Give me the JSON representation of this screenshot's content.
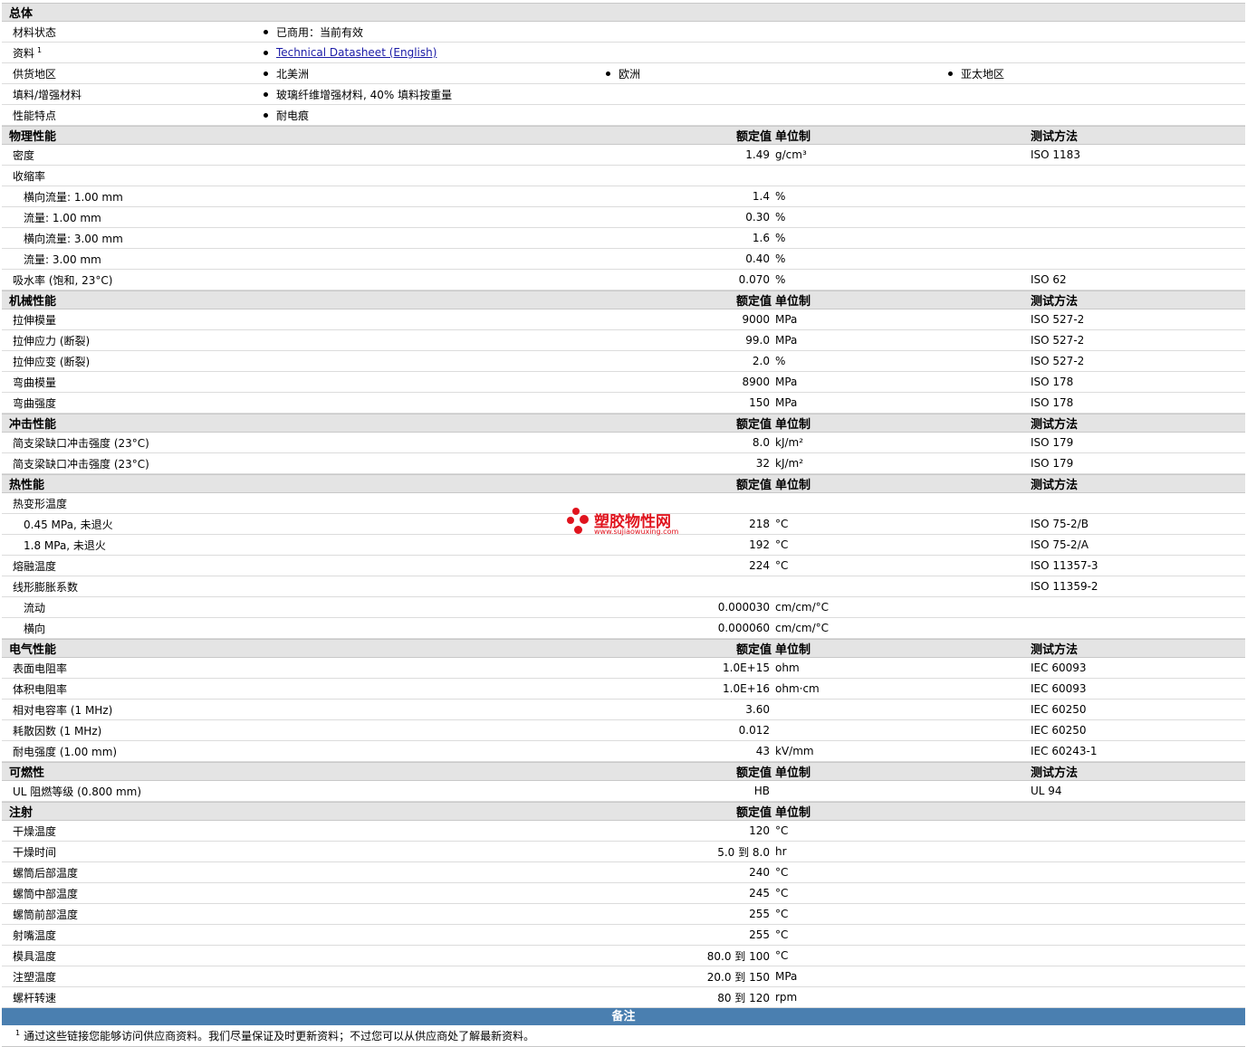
{
  "sections": [
    {
      "title": "总体",
      "headers": null,
      "rows": [
        {
          "type": "bullets",
          "label": "材料状态",
          "items": [
            "已商用：当前有效"
          ]
        },
        {
          "type": "bullets",
          "label": "资料",
          "sup": "1",
          "items": [
            "Technical Datasheet (English)"
          ],
          "link": true
        },
        {
          "type": "bullets",
          "label": "供货地区",
          "items": [
            "北美洲",
            "欧洲",
            "亚太地区"
          ]
        },
        {
          "type": "bullets",
          "label": "填料/增强材料",
          "items": [
            "玻璃纤维增强材料, 40% 填料按重量"
          ]
        },
        {
          "type": "bullets",
          "label": "性能特点",
          "items": [
            "耐电痕"
          ]
        }
      ]
    },
    {
      "title": "物理性能",
      "headers": {
        "value": "额定值",
        "unit": "单位制",
        "test": "测试方法"
      },
      "rows": [
        {
          "label": "密度",
          "value": "1.49",
          "unit": "g/cm³",
          "test": "ISO 1183"
        },
        {
          "label": "收缩率",
          "value": "",
          "unit": "",
          "test": ""
        },
        {
          "label": "横向流量: 1.00 mm",
          "sub": true,
          "value": "1.4",
          "unit": "%",
          "test": ""
        },
        {
          "label": "流量: 1.00 mm",
          "sub": true,
          "value": "0.30",
          "unit": "%",
          "test": ""
        },
        {
          "label": "横向流量: 3.00 mm",
          "sub": true,
          "value": "1.6",
          "unit": "%",
          "test": ""
        },
        {
          "label": "流量: 3.00 mm",
          "sub": true,
          "value": "0.40",
          "unit": "%",
          "test": ""
        },
        {
          "label": "吸水率 (饱和, 23°C)",
          "value": "0.070",
          "unit": "%",
          "test": "ISO 62"
        }
      ]
    },
    {
      "title": "机械性能",
      "headers": {
        "value": "额定值",
        "unit": "单位制",
        "test": "测试方法"
      },
      "rows": [
        {
          "label": "拉伸模量",
          "value": "9000",
          "unit": "MPa",
          "test": "ISO 527-2"
        },
        {
          "label": "拉伸应力 (断裂)",
          "value": "99.0",
          "unit": "MPa",
          "test": "ISO 527-2"
        },
        {
          "label": "拉伸应变 (断裂)",
          "value": "2.0",
          "unit": "%",
          "test": "ISO 527-2"
        },
        {
          "label": "弯曲模量",
          "value": "8900",
          "unit": "MPa",
          "test": "ISO 178"
        },
        {
          "label": "弯曲强度",
          "value": "150",
          "unit": "MPa",
          "test": "ISO 178"
        }
      ]
    },
    {
      "title": "冲击性能",
      "headers": {
        "value": "额定值",
        "unit": "单位制",
        "test": "测试方法"
      },
      "rows": [
        {
          "label": "简支梁缺口冲击强度 (23°C)",
          "value": "8.0",
          "unit": "kJ/m²",
          "test": "ISO 179"
        },
        {
          "label": "简支梁缺口冲击强度 (23°C)",
          "value": "32",
          "unit": "kJ/m²",
          "test": "ISO 179"
        }
      ]
    },
    {
      "title": "热性能",
      "headers": {
        "value": "额定值",
        "unit": "单位制",
        "test": "测试方法"
      },
      "rows": [
        {
          "label": "热变形温度",
          "value": "",
          "unit": "",
          "test": ""
        },
        {
          "label": "0.45 MPa, 未退火",
          "sub": true,
          "value": "218",
          "unit": "°C",
          "test": "ISO 75-2/B"
        },
        {
          "label": "1.8 MPa, 未退火",
          "sub": true,
          "value": "192",
          "unit": "°C",
          "test": "ISO 75-2/A"
        },
        {
          "label": "熔融温度",
          "value": "224",
          "unit": "°C",
          "test": "ISO 11357-3"
        },
        {
          "label": "线形膨胀系数",
          "value": "",
          "unit": "",
          "test": "ISO 11359-2"
        },
        {
          "label": "流动",
          "sub": true,
          "value": "0.000030",
          "unit": "cm/cm/°C",
          "test": ""
        },
        {
          "label": "横向",
          "sub": true,
          "value": "0.000060",
          "unit": "cm/cm/°C",
          "test": ""
        }
      ]
    },
    {
      "title": "电气性能",
      "headers": {
        "value": "额定值",
        "unit": "单位制",
        "test": "测试方法"
      },
      "rows": [
        {
          "label": "表面电阻率",
          "value": "1.0E+15",
          "unit": "ohm",
          "test": "IEC 60093"
        },
        {
          "label": "体积电阻率",
          "value": "1.0E+16",
          "unit": "ohm·cm",
          "test": "IEC 60093"
        },
        {
          "label": "相对电容率 (1 MHz)",
          "value": "3.60",
          "unit": "",
          "test": "IEC 60250"
        },
        {
          "label": "耗散因数 (1 MHz)",
          "value": "0.012",
          "unit": "",
          "test": "IEC 60250"
        },
        {
          "label": "耐电强度 (1.00 mm)",
          "value": "43",
          "unit": "kV/mm",
          "test": "IEC 60243-1"
        }
      ]
    },
    {
      "title": "可燃性",
      "headers": {
        "value": "额定值",
        "unit": "单位制",
        "test": "测试方法"
      },
      "rows": [
        {
          "label": "UL 阻燃等级 (0.800 mm)",
          "value": "HB",
          "unit": "",
          "test": "UL 94"
        }
      ]
    },
    {
      "title": "注射",
      "headers": {
        "value": "额定值",
        "unit": "单位制",
        "test": ""
      },
      "rows": [
        {
          "label": "干燥温度",
          "value": "120",
          "unit": "°C",
          "test": ""
        },
        {
          "label": "干燥时间",
          "value": "5.0 到  8.0",
          "unit": "hr",
          "test": ""
        },
        {
          "label": "螺筒后部温度",
          "value": "240",
          "unit": "°C",
          "test": ""
        },
        {
          "label": "螺筒中部温度",
          "value": "245",
          "unit": "°C",
          "test": ""
        },
        {
          "label": "螺筒前部温度",
          "value": "255",
          "unit": "°C",
          "test": ""
        },
        {
          "label": "射嘴温度",
          "value": "255",
          "unit": "°C",
          "test": ""
        },
        {
          "label": "模具温度",
          "value": "80.0 到  100",
          "unit": "°C",
          "test": ""
        },
        {
          "label": "注塑温度",
          "value": "20.0 到  150",
          "unit": "MPa",
          "test": ""
        },
        {
          "label": "螺杆转速",
          "value": "80 到  120",
          "unit": "rpm",
          "test": ""
        }
      ]
    }
  ],
  "notes": {
    "title": "备注",
    "items": [
      {
        "sup": "1",
        "text": "通过这些链接您能够访问供应商资料。我们尽量保证及时更新资料；不过您可以从供应商处了解最新资料。"
      }
    ]
  },
  "watermark": {
    "title": "塑胶物性网",
    "url": "www.sujiaowuxing.com",
    "color": "#e0141e"
  }
}
